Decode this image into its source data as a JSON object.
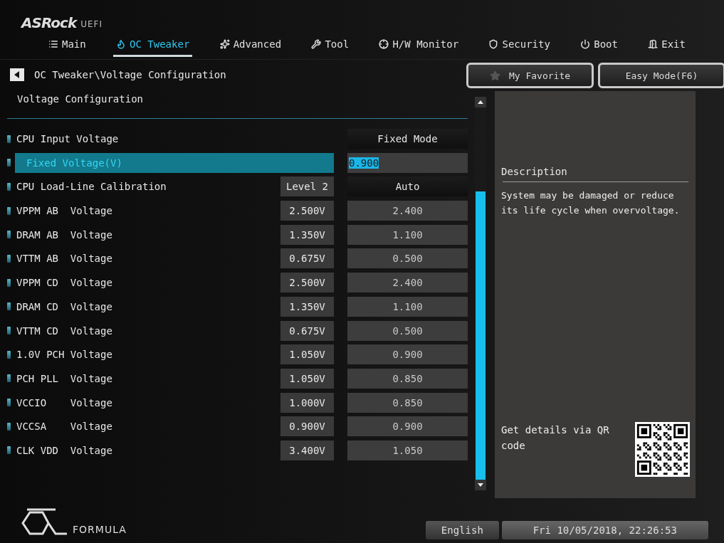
{
  "logo": {
    "brand": "ASRock",
    "suffix": "UEFI"
  },
  "tabs": [
    {
      "label": "Main",
      "selected": false
    },
    {
      "label": "OC Tweaker",
      "selected": true
    },
    {
      "label": "Advanced",
      "selected": false
    },
    {
      "label": "Tool",
      "selected": false
    },
    {
      "label": "H/W Monitor",
      "selected": false
    },
    {
      "label": "Security",
      "selected": false
    },
    {
      "label": "Boot",
      "selected": false
    },
    {
      "label": "Exit",
      "selected": false
    }
  ],
  "breadcrumb": "OC Tweaker\\Voltage Configuration",
  "section_title": "Voltage Configuration",
  "favorite_button": "My Favorite",
  "easy_mode_button": "Easy Mode(F6)",
  "settings": [
    {
      "label": "CPU Input Voltage",
      "kind": "select",
      "value": "Fixed Mode",
      "selected": false
    },
    {
      "label": "Fixed Voltage(V)",
      "kind": "input",
      "value": "0.900",
      "selected": true
    },
    {
      "label": "CPU Load-Line Calibration",
      "kind": "select",
      "current": "Level 2",
      "value": "Auto",
      "selected": false
    },
    {
      "label": "VPPM AB  Voltage",
      "kind": "input",
      "current": "2.500V",
      "value": "2.400",
      "selected": false
    },
    {
      "label": "DRAM AB  Voltage",
      "kind": "input",
      "current": "1.350V",
      "value": "1.100",
      "selected": false
    },
    {
      "label": "VTTM AB  Voltage",
      "kind": "input",
      "current": "0.675V",
      "value": "0.500",
      "selected": false
    },
    {
      "label": "VPPM CD  Voltage",
      "kind": "input",
      "current": "2.500V",
      "value": "2.400",
      "selected": false
    },
    {
      "label": "DRAM CD  Voltage",
      "kind": "input",
      "current": "1.350V",
      "value": "1.100",
      "selected": false
    },
    {
      "label": "VTTM CD  Voltage",
      "kind": "input",
      "current": "0.675V",
      "value": "0.500",
      "selected": false
    },
    {
      "label": "1.0V PCH Voltage",
      "kind": "input",
      "current": "1.050V",
      "value": "0.900",
      "selected": false
    },
    {
      "label": "PCH PLL  Voltage",
      "kind": "input",
      "current": "1.050V",
      "value": "0.850",
      "selected": false
    },
    {
      "label": "VCCIO    Voltage",
      "kind": "input",
      "current": "1.000V",
      "value": "0.850",
      "selected": false
    },
    {
      "label": "VCCSA    Voltage",
      "kind": "input",
      "current": "0.900V",
      "value": "0.900",
      "selected": false
    },
    {
      "label": "CLK VDD  Voltage",
      "kind": "input",
      "current": "3.400V",
      "value": "1.050",
      "selected": false
    }
  ],
  "description": {
    "title": "Description",
    "text": "System may be damaged or reduce its life cycle when overvoltage."
  },
  "qr_text": "Get details via QR code",
  "footer": {
    "brand": "FORMULA",
    "language": "English",
    "datetime": "Fri 10/05/2018, 22:26:53"
  }
}
